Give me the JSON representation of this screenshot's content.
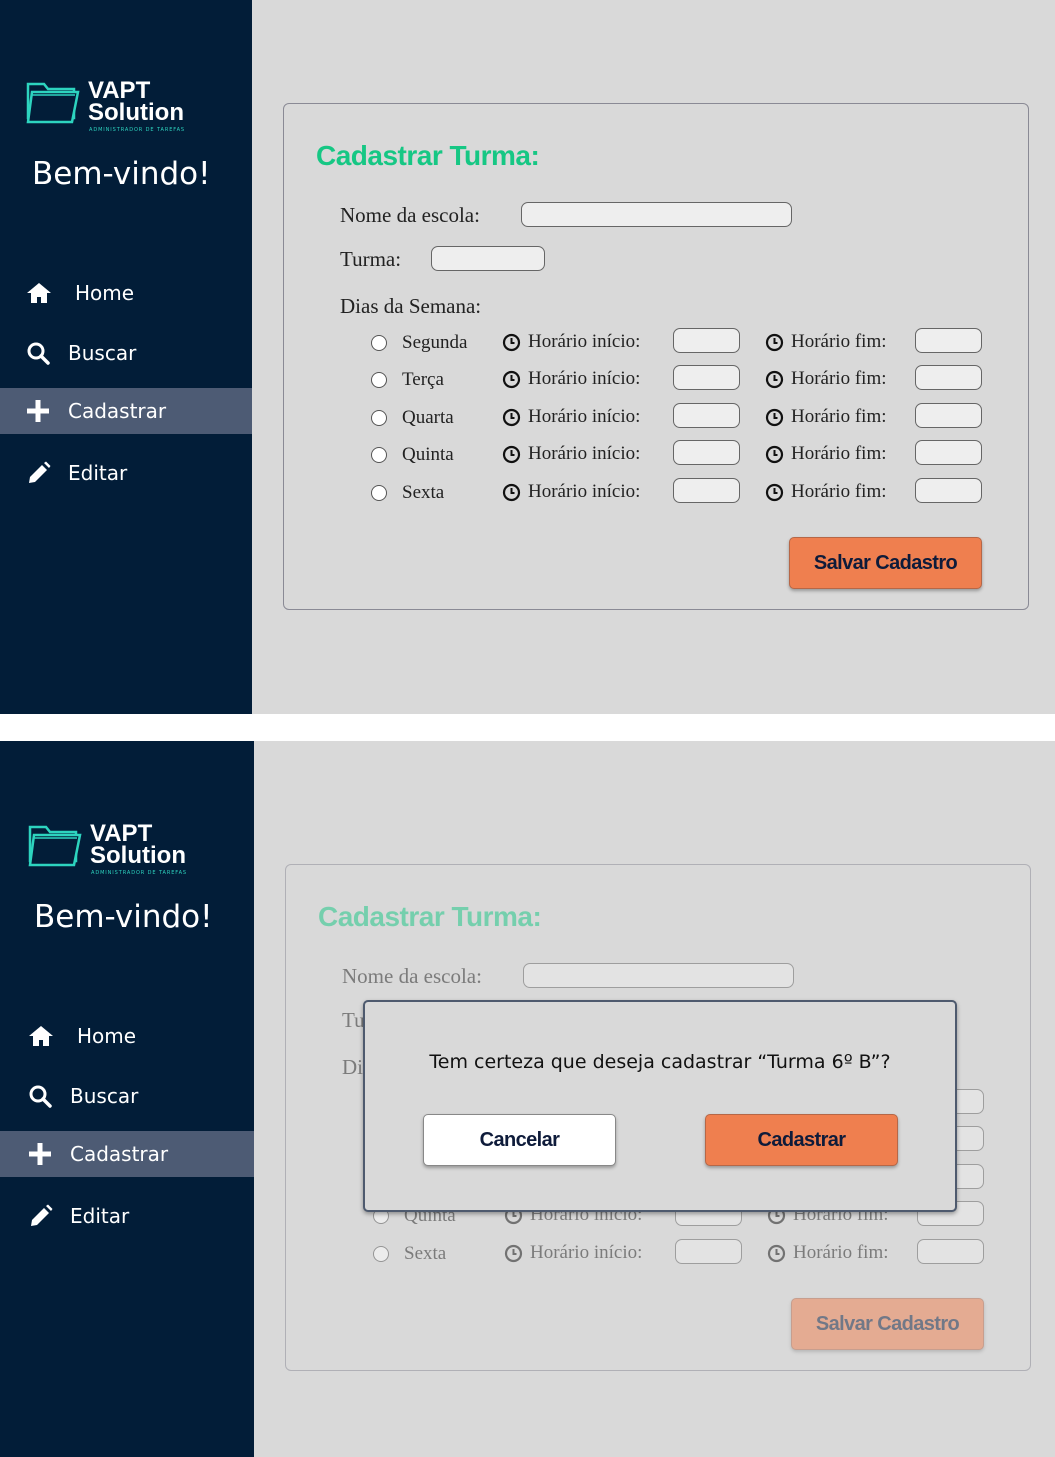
{
  "brand": {
    "name_line1": "VAPT",
    "name_line2": "Solution",
    "tagline": "ADMINISTRADOR DE TAREFAS",
    "accent_color": "#2dd4bf"
  },
  "sidebar": {
    "welcome": "Bem-vindo!",
    "items": [
      {
        "label": "Home",
        "icon": "home-icon"
      },
      {
        "label": "Buscar",
        "icon": "search-icon"
      },
      {
        "label": "Cadastrar",
        "icon": "plus-icon",
        "active": true
      },
      {
        "label": "Editar",
        "icon": "pencil-icon"
      }
    ]
  },
  "form": {
    "title": "Cadastrar Turma:",
    "school_label": "Nome da escola:",
    "school_value": "",
    "class_label": "Turma:",
    "class_value": "",
    "days_label": "Dias da Semana:",
    "days": [
      {
        "name": "Segunda",
        "start_label": "Horário início:",
        "end_label": "Horário fim:"
      },
      {
        "name": "Terça",
        "start_label": "Horário início:",
        "end_label": "Horário fim:"
      },
      {
        "name": "Quarta",
        "start_label": "Horário início:",
        "end_label": "Horário fim:"
      },
      {
        "name": "Quinta",
        "start_label": "Horário início:",
        "end_label": "Horário fim:"
      },
      {
        "name": "Sexta",
        "start_label": "Horário início:",
        "end_label": "Horário fim:"
      }
    ],
    "save_label": "Salvar Cadastro"
  },
  "modal": {
    "message": "Tem certeza que deseja cadastrar “Turma 6º B”?",
    "cancel_label": "Cancelar",
    "confirm_label": "Cadastrar"
  },
  "colors": {
    "sidebar_bg": "#021d38",
    "active_nav": "#4d5b74",
    "title_green": "#16c784",
    "button_orange": "#ef7f4f",
    "page_bg": "#d9d9d9"
  }
}
